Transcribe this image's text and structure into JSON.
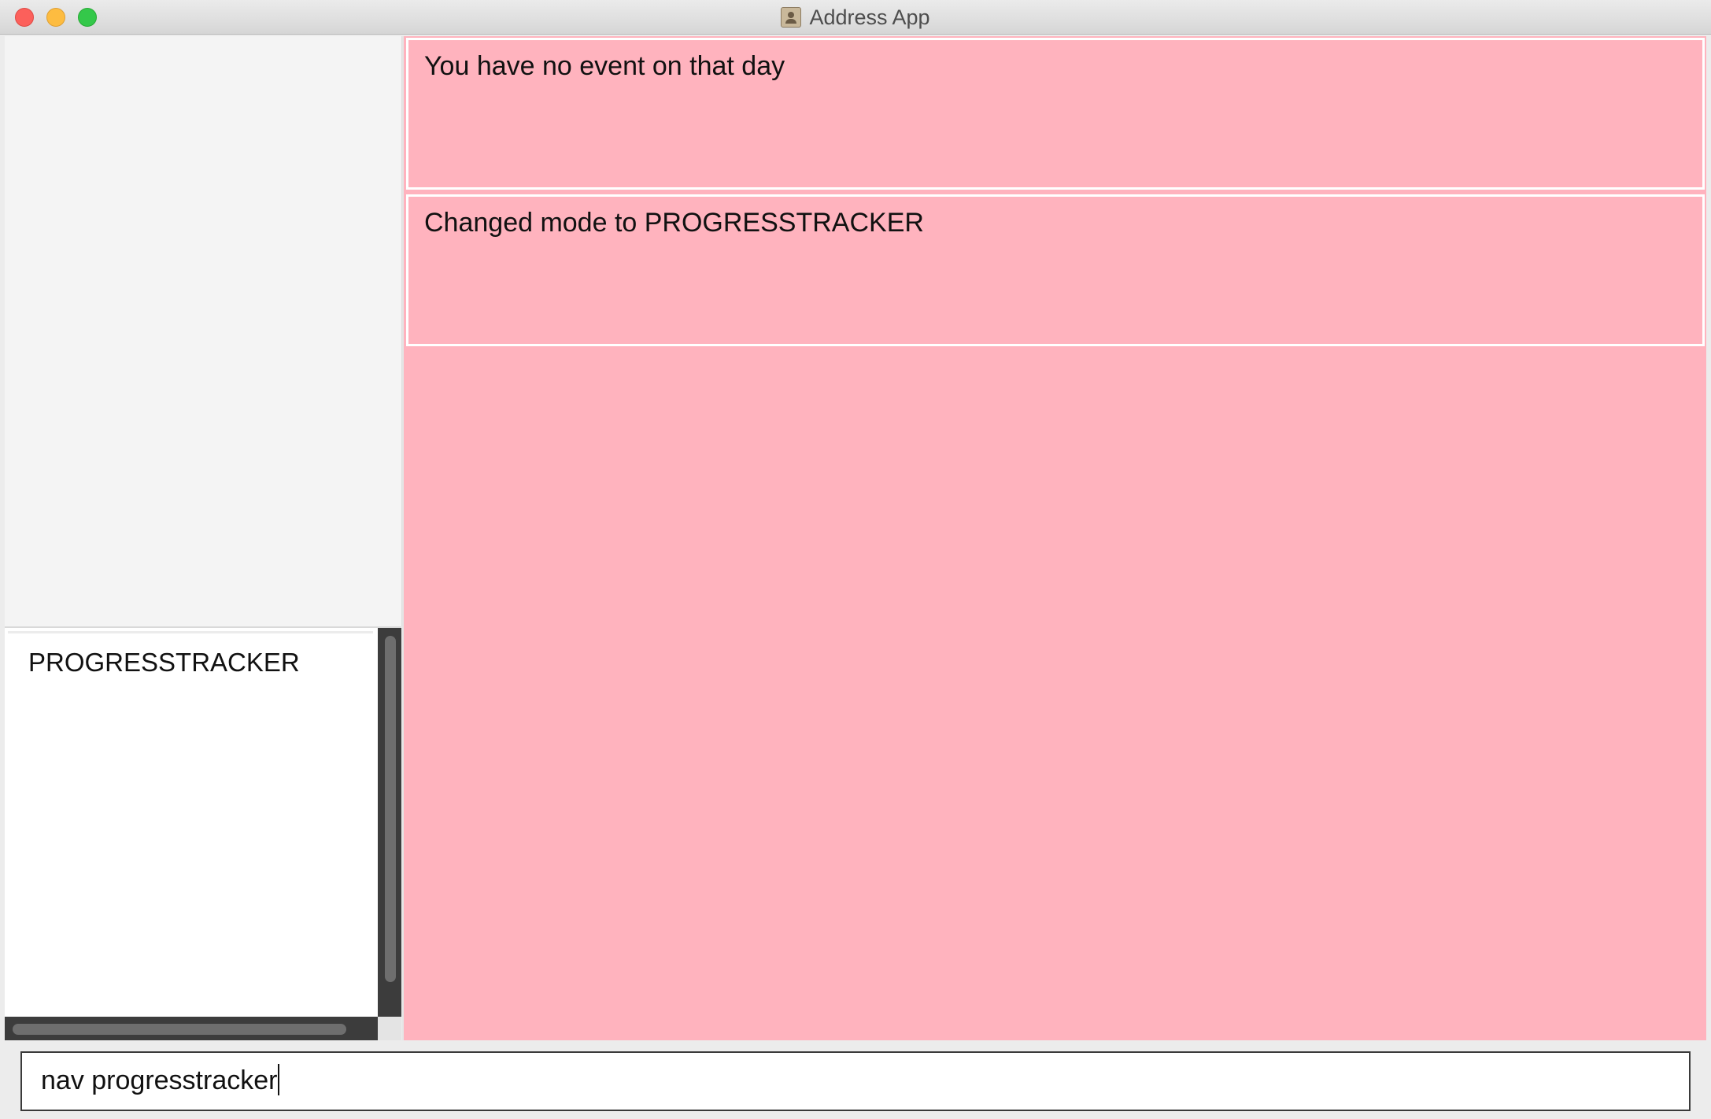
{
  "window": {
    "title": "Address App",
    "app_icon": "address-book-icon",
    "traffic_lights": [
      "close",
      "minimize",
      "maximize"
    ]
  },
  "left_panel": {
    "mode_list": {
      "items": [
        {
          "label": "PROGRESSTRACKER"
        }
      ]
    }
  },
  "result_display": {
    "messages": [
      {
        "text": "You have no event on that day"
      },
      {
        "text": "Changed mode to PROGRESSTRACKER"
      }
    ],
    "background_color": "#ffb3be"
  },
  "command_box": {
    "value": "nav progresstracker"
  }
}
